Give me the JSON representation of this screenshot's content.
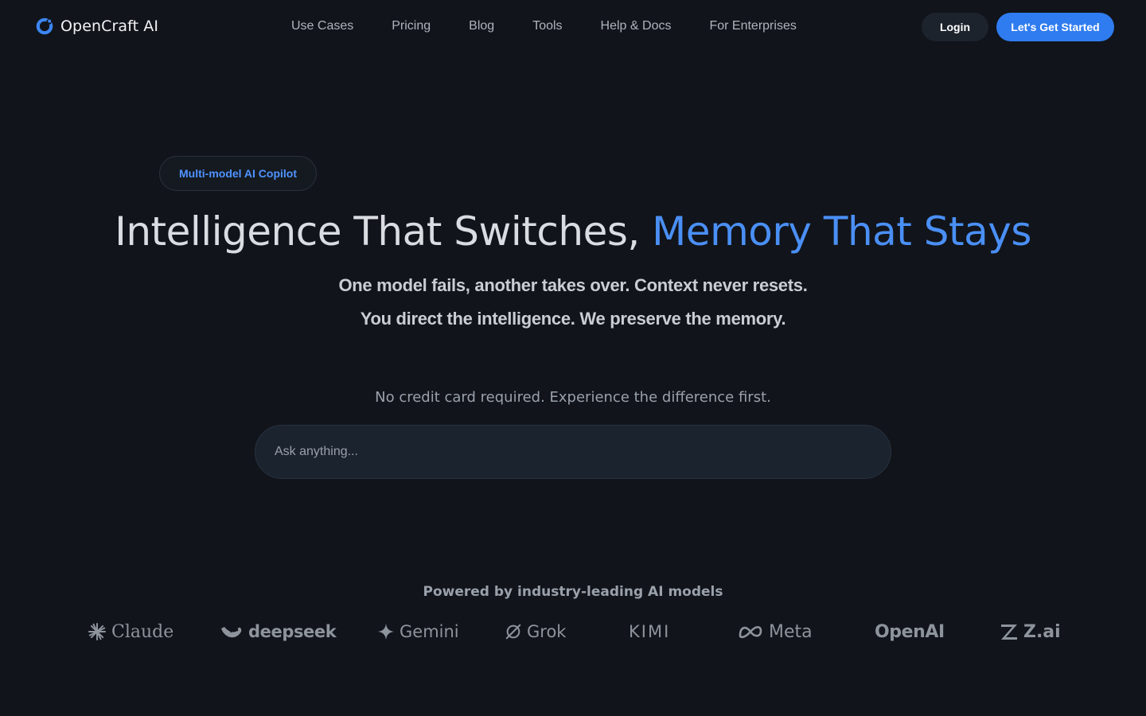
{
  "header": {
    "brand": "OpenCraft AI",
    "nav": [
      {
        "label": "Use Cases"
      },
      {
        "label": "Pricing"
      },
      {
        "label": "Blog"
      },
      {
        "label": "Tools"
      },
      {
        "label": "Help & Docs"
      },
      {
        "label": "For Enterprises"
      }
    ],
    "login_label": "Login",
    "start_label": "Let's Get Started"
  },
  "hero": {
    "badge": "Multi-model AI Copilot",
    "title_part1": "Intelligence That Switches, ",
    "title_accent": "Memory That Stays",
    "subtitle_line1": "One model fails, another takes over. Context never resets.",
    "subtitle_line2": "You direct the intelligence. We preserve the memory.",
    "no_credit_card": "No credit card required. Experience the difference first.",
    "ask_placeholder": "Ask anything..."
  },
  "models": {
    "heading": "Powered by industry-leading AI models",
    "items": [
      {
        "name": "Claude",
        "icon": "claude-spark-icon"
      },
      {
        "name": "deepseek",
        "icon": "deepseek-whale-icon"
      },
      {
        "name": "Gemini",
        "icon": "gemini-star-icon"
      },
      {
        "name": "Grok",
        "icon": "grok-slash-icon"
      },
      {
        "name": "KIMI",
        "icon": ""
      },
      {
        "name": "Meta",
        "icon": "meta-infinity-icon"
      },
      {
        "name": "OpenAI",
        "icon": ""
      },
      {
        "name": "Z.ai",
        "icon": "zai-z-icon"
      }
    ]
  },
  "colors": {
    "background": "#11141a",
    "accent": "#2f7cf0",
    "title_accent": "#4a8ff5",
    "badge_text": "#4f93ff"
  }
}
